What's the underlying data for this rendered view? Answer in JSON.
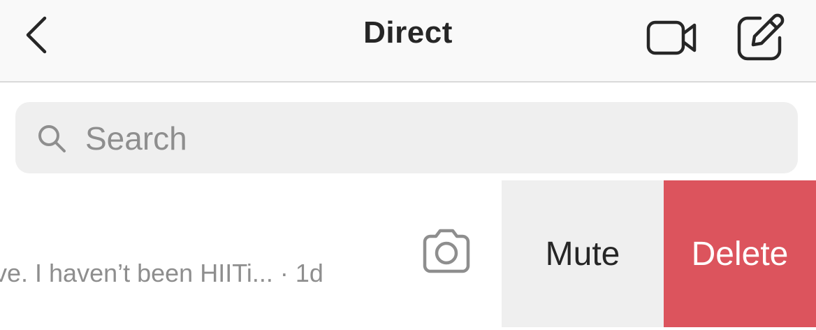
{
  "header": {
    "title": "Direct",
    "back_icon": "chevron-left-icon",
    "video_icon": "video-camera-icon",
    "compose_icon": "new-message-icon"
  },
  "search": {
    "placeholder": "Search",
    "value": "",
    "icon": "search-icon"
  },
  "thread": {
    "preview": "ve. I haven’t been HIITi... · 1d",
    "camera_icon": "camera-icon",
    "actions": {
      "mute_label": "Mute",
      "delete_label": "Delete",
      "delete_color": "#dc545d",
      "mute_color": "#efefef"
    }
  }
}
